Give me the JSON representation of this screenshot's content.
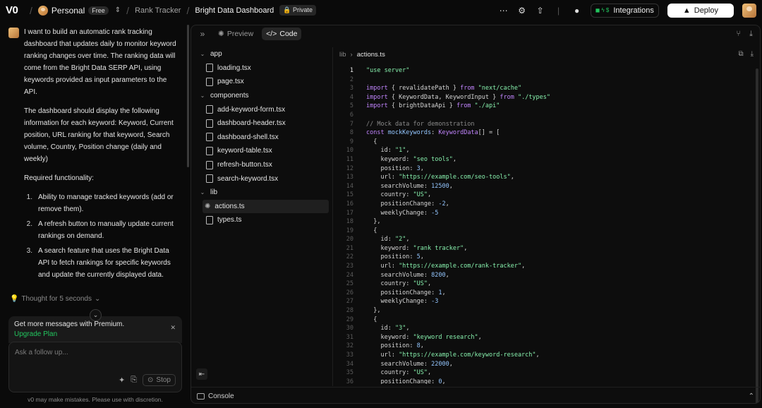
{
  "topbar": {
    "logo": "V0",
    "workspace": "Personal",
    "plan_badge": "Free",
    "breadcrumb_parent": "Rank Tracker",
    "project_title": "Bright Data Dashboard",
    "visibility": "Private",
    "integrations_label": "Integrations",
    "deploy_label": "Deploy"
  },
  "chat": {
    "paragraphs": [
      "I want to build an automatic rank tracking dashboard that updates daily to monitor keyword ranking changes over time. The ranking data will come from the Bright Data SERP API, using keywords provided as input parameters to the API.",
      "The dashboard should display the following information for each keyword: Keyword, Current position, URL ranking for that keyword, Search volume, Country, Position change (daily and weekly)",
      "Required functionality:"
    ],
    "list": [
      {
        "num": "1.",
        "text": "Ability to manage tracked keywords (add or remove them)."
      },
      {
        "num": "2.",
        "text": "A refresh button to manually update current rankings on demand."
      },
      {
        "num": "3.",
        "text": "A search feature that uses the Bright Data API to fetch rankings for specific keywords and update the currently displayed data."
      }
    ],
    "thought": "Thought for 5 seconds",
    "premium_text": "Get more messages with Premium.",
    "premium_link": "Upgrade Plan",
    "input_placeholder": "Ask a follow up...",
    "stop_label": "Stop",
    "disclaimer": "v0 may make mistakes. Please use with discretion."
  },
  "panel": {
    "tab_preview": "Preview",
    "tab_code": "Code",
    "console_label": "Console"
  },
  "tree": [
    {
      "type": "folder",
      "name": "app"
    },
    {
      "type": "file",
      "name": "loading.tsx"
    },
    {
      "type": "file",
      "name": "page.tsx"
    },
    {
      "type": "folder",
      "name": "components"
    },
    {
      "type": "file",
      "name": "add-keyword-form.tsx"
    },
    {
      "type": "file",
      "name": "dashboard-header.tsx"
    },
    {
      "type": "file",
      "name": "dashboard-shell.tsx"
    },
    {
      "type": "file",
      "name": "keyword-table.tsx"
    },
    {
      "type": "file",
      "name": "refresh-button.tsx"
    },
    {
      "type": "file",
      "name": "search-keyword.tsx"
    },
    {
      "type": "folder",
      "name": "lib"
    },
    {
      "type": "selected",
      "name": "actions.ts"
    },
    {
      "type": "file",
      "name": "types.ts"
    }
  ],
  "editor": {
    "breadcrumb_dir": "lib",
    "breadcrumb_file": "actions.ts",
    "current_line": 1,
    "lines": [
      [
        [
          "\"use server\"",
          "#86efac"
        ]
      ],
      [],
      [
        [
          "import",
          "#c084fc"
        ],
        [
          " { revalidatePath } ",
          "#d4d4d4"
        ],
        [
          "from",
          "#c084fc"
        ],
        [
          " \"next/cache\"",
          "#86efac"
        ]
      ],
      [
        [
          "import",
          "#c084fc"
        ],
        [
          " { KeywordData, KeywordInput } ",
          "#d4d4d4"
        ],
        [
          "from",
          "#c084fc"
        ],
        [
          " \"./types\"",
          "#86efac"
        ]
      ],
      [
        [
          "import",
          "#c084fc"
        ],
        [
          " { brightDataApi } ",
          "#d4d4d4"
        ],
        [
          "from",
          "#c084fc"
        ],
        [
          " \"./api\"",
          "#86efac"
        ]
      ],
      [],
      [
        [
          "// Mock data for demonstration",
          "#8a8a8a"
        ]
      ],
      [
        [
          "const",
          "#c084fc"
        ],
        [
          " mockKeywords",
          "#93c5fd"
        ],
        [
          ": ",
          "#d4d4d4"
        ],
        [
          "KeywordData",
          "#c084fc"
        ],
        [
          "[] = [",
          "#d4d4d4"
        ]
      ],
      [
        [
          "  {",
          "#d4d4d4"
        ]
      ],
      [
        [
          "    id: ",
          "#d4d4d4"
        ],
        [
          "\"1\"",
          "#86efac"
        ],
        [
          ",",
          "#d4d4d4"
        ]
      ],
      [
        [
          "    keyword: ",
          "#d4d4d4"
        ],
        [
          "\"seo tools\"",
          "#86efac"
        ],
        [
          ",",
          "#d4d4d4"
        ]
      ],
      [
        [
          "    position: ",
          "#d4d4d4"
        ],
        [
          "3",
          "#93c5fd"
        ],
        [
          ",",
          "#d4d4d4"
        ]
      ],
      [
        [
          "    url: ",
          "#d4d4d4"
        ],
        [
          "\"https://example.com/seo-tools\"",
          "#86efac"
        ],
        [
          ",",
          "#d4d4d4"
        ]
      ],
      [
        [
          "    searchVolume: ",
          "#d4d4d4"
        ],
        [
          "12500",
          "#93c5fd"
        ],
        [
          ",",
          "#d4d4d4"
        ]
      ],
      [
        [
          "    country: ",
          "#d4d4d4"
        ],
        [
          "\"US\"",
          "#86efac"
        ],
        [
          ",",
          "#d4d4d4"
        ]
      ],
      [
        [
          "    positionChange: ",
          "#d4d4d4"
        ],
        [
          "-2",
          "#93c5fd"
        ],
        [
          ",",
          "#d4d4d4"
        ]
      ],
      [
        [
          "    weeklyChange: ",
          "#d4d4d4"
        ],
        [
          "-5",
          "#93c5fd"
        ]
      ],
      [
        [
          "  },",
          "#d4d4d4"
        ]
      ],
      [
        [
          "  {",
          "#d4d4d4"
        ]
      ],
      [
        [
          "    id: ",
          "#d4d4d4"
        ],
        [
          "\"2\"",
          "#86efac"
        ],
        [
          ",",
          "#d4d4d4"
        ]
      ],
      [
        [
          "    keyword: ",
          "#d4d4d4"
        ],
        [
          "\"rank tracker\"",
          "#86efac"
        ],
        [
          ",",
          "#d4d4d4"
        ]
      ],
      [
        [
          "    position: ",
          "#d4d4d4"
        ],
        [
          "5",
          "#93c5fd"
        ],
        [
          ",",
          "#d4d4d4"
        ]
      ],
      [
        [
          "    url: ",
          "#d4d4d4"
        ],
        [
          "\"https://example.com/rank-tracker\"",
          "#86efac"
        ],
        [
          ",",
          "#d4d4d4"
        ]
      ],
      [
        [
          "    searchVolume: ",
          "#d4d4d4"
        ],
        [
          "8200",
          "#93c5fd"
        ],
        [
          ",",
          "#d4d4d4"
        ]
      ],
      [
        [
          "    country: ",
          "#d4d4d4"
        ],
        [
          "\"US\"",
          "#86efac"
        ],
        [
          ",",
          "#d4d4d4"
        ]
      ],
      [
        [
          "    positionChange: ",
          "#d4d4d4"
        ],
        [
          "1",
          "#93c5fd"
        ],
        [
          ",",
          "#d4d4d4"
        ]
      ],
      [
        [
          "    weeklyChange: ",
          "#d4d4d4"
        ],
        [
          "-3",
          "#93c5fd"
        ]
      ],
      [
        [
          "  },",
          "#d4d4d4"
        ]
      ],
      [
        [
          "  {",
          "#d4d4d4"
        ]
      ],
      [
        [
          "    id: ",
          "#d4d4d4"
        ],
        [
          "\"3\"",
          "#86efac"
        ],
        [
          ",",
          "#d4d4d4"
        ]
      ],
      [
        [
          "    keyword: ",
          "#d4d4d4"
        ],
        [
          "\"keyword research\"",
          "#86efac"
        ],
        [
          ",",
          "#d4d4d4"
        ]
      ],
      [
        [
          "    position: ",
          "#d4d4d4"
        ],
        [
          "8",
          "#93c5fd"
        ],
        [
          ",",
          "#d4d4d4"
        ]
      ],
      [
        [
          "    url: ",
          "#d4d4d4"
        ],
        [
          "\"https://example.com/keyword-research\"",
          "#86efac"
        ],
        [
          ",",
          "#d4d4d4"
        ]
      ],
      [
        [
          "    searchVolume: ",
          "#d4d4d4"
        ],
        [
          "22000",
          "#93c5fd"
        ],
        [
          ",",
          "#d4d4d4"
        ]
      ],
      [
        [
          "    country: ",
          "#d4d4d4"
        ],
        [
          "\"US\"",
          "#86efac"
        ],
        [
          ",",
          "#d4d4d4"
        ]
      ],
      [
        [
          "    positionChange: ",
          "#d4d4d4"
        ],
        [
          "0",
          "#93c5fd"
        ],
        [
          ",",
          "#d4d4d4"
        ]
      ]
    ]
  },
  "colors": {
    "accent_green": "#22c55e",
    "string": "#86efac",
    "keyword": "#c084fc",
    "number": "#93c5fd"
  }
}
